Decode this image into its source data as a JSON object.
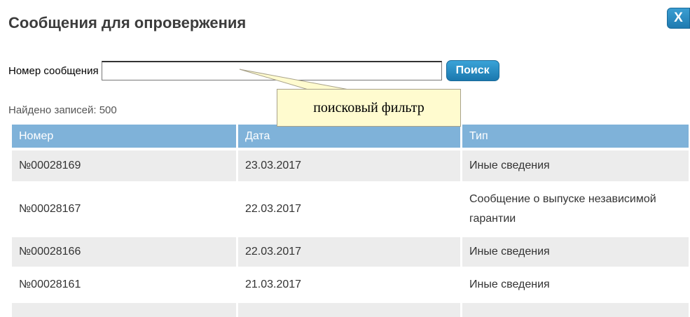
{
  "dialog": {
    "title": "Сообщения для опровержения",
    "close_label": "X"
  },
  "search": {
    "label": "Номер сообщения",
    "value": "",
    "button_label": "Поиск"
  },
  "results": {
    "count_text": "Найдено записей: 500"
  },
  "annotation": {
    "text": "поисковый фильтр"
  },
  "table": {
    "columns": [
      "Номер",
      "Дата",
      "Тип"
    ],
    "rows": [
      {
        "number": "№00028169",
        "date": "23.03.2017",
        "type": "Иные сведения"
      },
      {
        "number": "№00028167",
        "date": "22.03.2017",
        "type": "Сообщение о выпуске независимой гарантии"
      },
      {
        "number": "№00028166",
        "date": "22.03.2017",
        "type": "Иные сведения"
      },
      {
        "number": "№00028161",
        "date": "21.03.2017",
        "type": "Иные сведения"
      }
    ]
  },
  "colors": {
    "header_bg": "#7fb2d9",
    "button_blue": "#1f7ab0",
    "row_stripe": "#ececec",
    "callout_bg": "#fffbcf"
  }
}
